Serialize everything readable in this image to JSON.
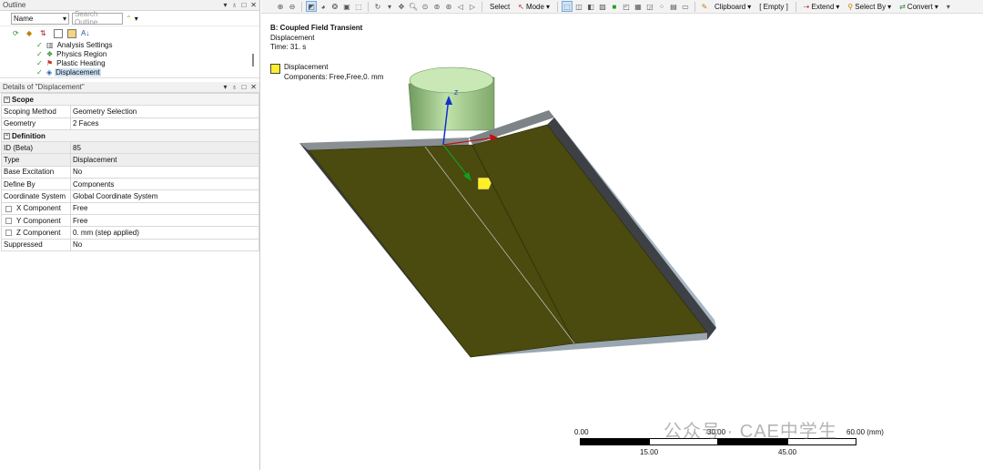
{
  "outline": {
    "title": "Outline",
    "filter_select": "Name",
    "search_placeholder": "Search Outline",
    "items": [
      {
        "label": "Analysis Settings"
      },
      {
        "label": "Physics Region"
      },
      {
        "label": "Plastic Heating"
      },
      {
        "label": "Displacement"
      }
    ]
  },
  "details": {
    "title": "Details of \"Displacement\"",
    "groups": [
      {
        "name": "Scope",
        "rows": [
          {
            "key": "Scoping Method",
            "value": "Geometry Selection"
          },
          {
            "key": "Geometry",
            "value": "2 Faces"
          }
        ]
      },
      {
        "name": "Definition",
        "rows": [
          {
            "key": "ID (Beta)",
            "value": "85"
          },
          {
            "key": "Type",
            "value": "Displacement"
          },
          {
            "key": "Base Excitation",
            "value": "No"
          },
          {
            "key": "Define By",
            "value": "Components"
          },
          {
            "key": "Coordinate System",
            "value": "Global Coordinate System"
          },
          {
            "key": "X Component",
            "value": "Free"
          },
          {
            "key": "Y Component",
            "value": "Free"
          },
          {
            "key": "Z Component",
            "value": "0. mm  (step applied)"
          },
          {
            "key": "Suppressed",
            "value": "No"
          }
        ]
      }
    ]
  },
  "toolbar": {
    "select": "Select",
    "mode": "Mode",
    "clipboard": "Clipboard",
    "empty": "[ Empty ]",
    "extend": "Extend",
    "select_by": "Select By",
    "convert": "Convert"
  },
  "viewport": {
    "title": "B: Coupled Field Transient",
    "subtitle": "Displacement",
    "time": "Time: 31. s",
    "legend_label": "Displacement",
    "legend_components": "Components: Free,Free,0. mm",
    "axis_z": "Z",
    "scale_top_left": "0.00",
    "scale_top_mid": "30.00",
    "scale_top_right": "60.00 (mm)",
    "scale_bottom_left": "15.00",
    "scale_bottom_right": "45.00",
    "watermark": "公众号 · CAE中学生"
  },
  "colors": {
    "plate_face": "#4b4a0f",
    "plate_edge": "#9fb0c0",
    "cylinder": "#9fc48a",
    "legend_swatch": "#ffef29",
    "selection": "#cfe3f7"
  }
}
